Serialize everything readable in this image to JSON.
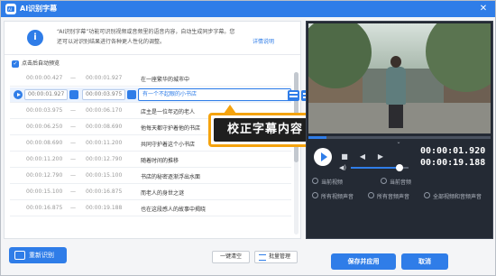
{
  "window": {
    "title": "AI识别字幕",
    "accent": "#2f7de8"
  },
  "info": {
    "text": "“AI识别字幕”功能可识别视频或音频里的语音内容，自动生成同步字幕。您还可以对识别结果进行各种更人性化的调整。",
    "link": "详情说明"
  },
  "auto_preview": {
    "label": "点击后自动预览",
    "checked": true
  },
  "subtitles": [
    {
      "start": "00:00:00.427",
      "end": "00:00:01.927",
      "text": "在一座繁华的城市中"
    },
    {
      "start": "00:00:01.927",
      "end": "00:00:03.975",
      "text": "有一个不起眼的小书店",
      "active": true
    },
    {
      "start": "00:00:03.975",
      "end": "00:00:06.170",
      "text": "店主是一位年迈的老人"
    },
    {
      "start": "00:00:06.250",
      "end": "00:00:08.690",
      "text": "他每天都守护着他的书店"
    },
    {
      "start": "00:00:08.690",
      "end": "00:00:11.200",
      "text": "共同守护着这个小书店"
    },
    {
      "start": "00:00:11.200",
      "end": "00:00:12.790",
      "text": "随着时间的推移"
    },
    {
      "start": "00:00:12.790",
      "end": "00:00:15.100",
      "text": "书店的秘密逐渐浮出水面"
    },
    {
      "start": "00:00:15.100",
      "end": "00:00:16.875",
      "text": "而老人的身世之谜"
    },
    {
      "start": "00:00:16.875",
      "end": "00:00:19.188",
      "text": "也在这段感人的故事中揭晓"
    }
  ],
  "callout": {
    "text": "校正字幕内容"
  },
  "buttons": {
    "re_recognize": "重新识别",
    "clear": "一键清空",
    "batch": "批量管理",
    "apply": "保存并应用",
    "cancel": "取消"
  },
  "player": {
    "current_time": "00:00:01.920",
    "total_time": "00:00:19.188",
    "progress": 0.1,
    "volume": 0.85
  },
  "apply_options": [
    {
      "label": "当前视频"
    },
    {
      "label": "当前音频"
    },
    {
      "label": "所有视频声音"
    },
    {
      "label": "所有音频声音"
    },
    {
      "label": "全部视频和音频声音"
    }
  ],
  "icons": {
    "close": "close-icon",
    "info": "info-icon",
    "play": "play-icon",
    "stop": "stop-icon",
    "prev": "prev-frame-icon",
    "next": "next-frame-icon",
    "volume": "volume-icon"
  }
}
